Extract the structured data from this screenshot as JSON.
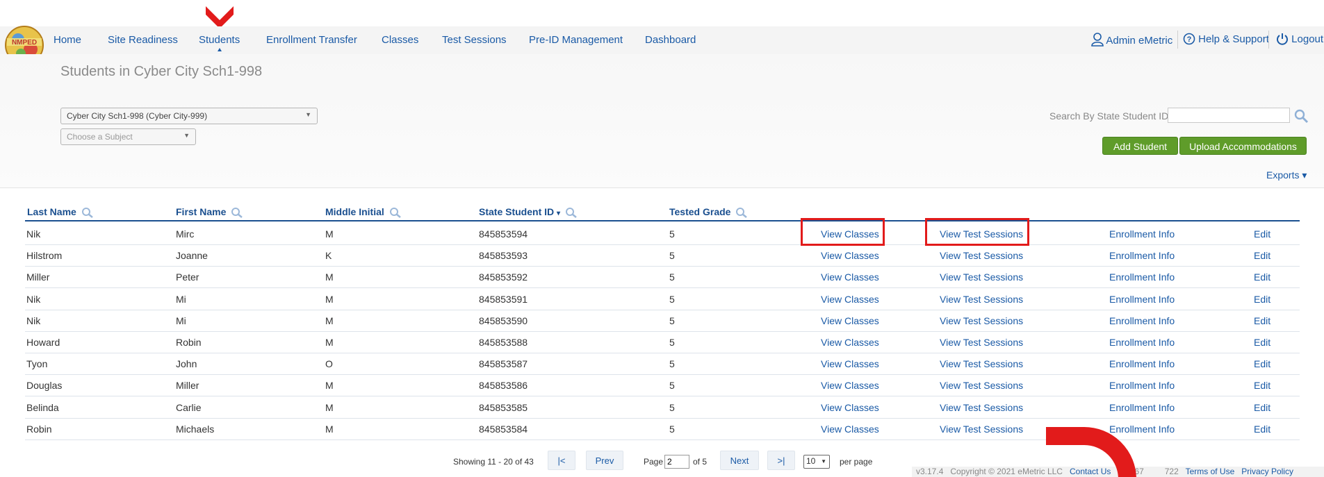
{
  "nav": {
    "items": [
      "Home",
      "Site Readiness",
      "Students",
      "Enrollment Transfer",
      "Classes",
      "Test Sessions",
      "Pre-ID Management",
      "Dashboard"
    ],
    "logo_text": "NMPED",
    "user": "Admin eMetric",
    "help": "Help & Support",
    "logout": "Logout"
  },
  "page": {
    "title": "Students in Cyber City Sch1-998",
    "school_select": "Cyber City Sch1-998 (Cyber City-999)",
    "subject_select": "Choose a Subject",
    "search_label": "Search By State Student ID:",
    "search_value": "",
    "add_student": "Add Student",
    "upload_accommodations": "Upload Accommodations",
    "exports": "Exports ▾"
  },
  "table": {
    "headers": {
      "last": "Last Name",
      "first": "First Name",
      "middle": "Middle Initial",
      "ssid": "State Student ID",
      "ssid_sort": "▾",
      "grade": "Tested Grade"
    },
    "actions": {
      "classes": "View Classes",
      "sessions": "View Test Sessions",
      "enrollment": "Enrollment Info",
      "edit": "Edit"
    },
    "rows": [
      {
        "last": "Nik",
        "first": "Mirc",
        "middle": "M",
        "ssid": "845853594",
        "grade": "5"
      },
      {
        "last": "Hilstrom",
        "first": "Joanne",
        "middle": "K",
        "ssid": "845853593",
        "grade": "5"
      },
      {
        "last": "Miller",
        "first": "Peter",
        "middle": "M",
        "ssid": "845853592",
        "grade": "5"
      },
      {
        "last": "Nik",
        "first": "Mi",
        "middle": "M",
        "ssid": "845853591",
        "grade": "5"
      },
      {
        "last": "Nik",
        "first": "Mi",
        "middle": "M",
        "ssid": "845853590",
        "grade": "5"
      },
      {
        "last": "Howard",
        "first": "Robin",
        "middle": "M",
        "ssid": "845853588",
        "grade": "5"
      },
      {
        "last": "Tyon",
        "first": "John",
        "middle": "O",
        "ssid": "845853587",
        "grade": "5"
      },
      {
        "last": "Douglas",
        "first": "Miller",
        "middle": "M",
        "ssid": "845853586",
        "grade": "5"
      },
      {
        "last": "Belinda",
        "first": "Carlie",
        "middle": "M",
        "ssid": "845853585",
        "grade": "5"
      },
      {
        "last": "Robin",
        "first": "Michaels",
        "middle": "M",
        "ssid": "845853584",
        "grade": "5"
      }
    ]
  },
  "pager": {
    "showing": "Showing 11 - 20 of 43",
    "first": "|<",
    "prev": "Prev",
    "page_label": "Page",
    "page_value": "2",
    "of": "of 5",
    "next": "Next",
    "last": ">|",
    "per_page_value": "10",
    "per_page_label": "per page"
  },
  "footer": {
    "version": "v3.17.4",
    "copyright": "Copyright © 2021 eMetric LLC",
    "contact": "Contact Us",
    "phone": "877-67",
    "phone_end": "722",
    "terms": "Terms of Use",
    "privacy": "Privacy Policy"
  },
  "colors": {
    "link": "#1a5aa6",
    "header": "#1a4f8f",
    "green_button": "#5f9c2a",
    "annotation_red": "#e21b1b"
  }
}
